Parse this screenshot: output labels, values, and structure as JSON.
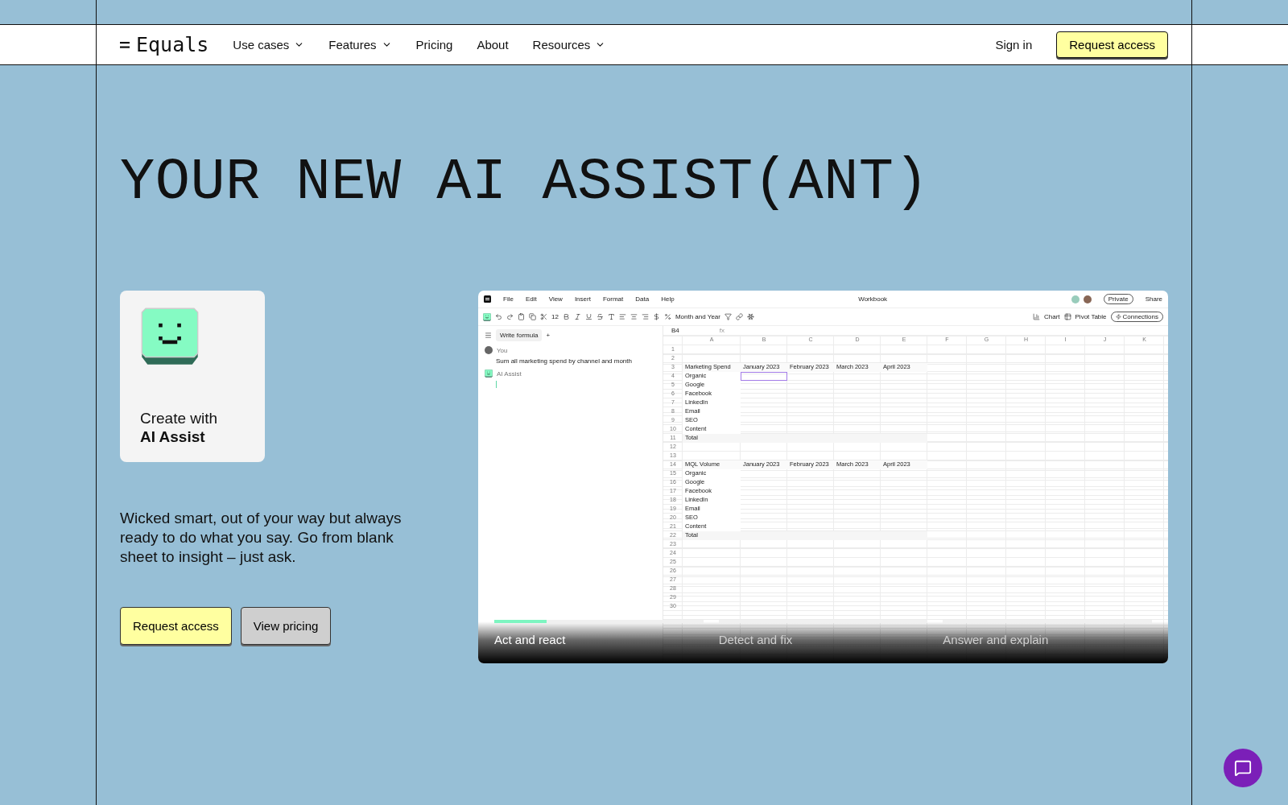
{
  "nav": {
    "logo": "Equals",
    "items": [
      {
        "label": "Use cases",
        "has_menu": true
      },
      {
        "label": "Features",
        "has_menu": true
      },
      {
        "label": "Pricing",
        "has_menu": false
      },
      {
        "label": "About",
        "has_menu": false
      },
      {
        "label": "Resources",
        "has_menu": true
      }
    ],
    "sign_in": "Sign in",
    "cta": "Request access"
  },
  "hero": {
    "headline": "YOUR NEW AI ASSIST(ANT)",
    "card": {
      "line1": "Create with",
      "line2": "AI Assist"
    },
    "description": "Wicked smart, out of your way but always ready to do what you say. Go from blank sheet to insight – just ask.",
    "buttons": [
      {
        "label": "Request access",
        "kind": "primary"
      },
      {
        "label": "View pricing",
        "kind": "secondary"
      }
    ]
  },
  "app": {
    "menu": [
      "File",
      "Edit",
      "View",
      "Insert",
      "Format",
      "Data",
      "Help"
    ],
    "title": "Workbook",
    "visibility": "Private",
    "share": "Share",
    "font_size": "12",
    "number_format": "Month and Year",
    "actions": [
      "Chart",
      "Pivot Table",
      "Connections"
    ],
    "panel": {
      "tab": "Write formula",
      "add": "+",
      "messages": [
        {
          "kind": "user",
          "author": "You",
          "text": "Sum all marketing spend by channel and month"
        },
        {
          "kind": "assistant",
          "author": "AI Assist"
        }
      ]
    },
    "cell_ref": "B4",
    "fx": "fx",
    "columns": [
      "A",
      "B",
      "C",
      "D",
      "E",
      "F",
      "G",
      "H",
      "I",
      "J",
      "K"
    ],
    "rows": [
      {
        "n": "1",
        "kind": "empty",
        "selected": false
      },
      {
        "n": "2",
        "kind": "empty",
        "selected": false
      },
      {
        "n": "3",
        "kind": "header",
        "cells": [
          "Marketing Spend",
          "January 2023",
          "February 2023",
          "March 2023",
          "April 2023"
        ],
        "selected": false
      },
      {
        "n": "4",
        "kind": "item",
        "cells": [
          "Organic"
        ],
        "selected": true
      },
      {
        "n": "5",
        "kind": "item",
        "cells": [
          "Google"
        ],
        "selected": false
      },
      {
        "n": "6",
        "kind": "item",
        "cells": [
          "Facebook"
        ],
        "selected": false
      },
      {
        "n": "7",
        "kind": "item",
        "cells": [
          "LinkedIn"
        ],
        "selected": false
      },
      {
        "n": "8",
        "kind": "item",
        "cells": [
          "Email"
        ],
        "selected": false
      },
      {
        "n": "9",
        "kind": "item",
        "cells": [
          "SEO"
        ],
        "selected": false
      },
      {
        "n": "10",
        "kind": "item",
        "cells": [
          "Content"
        ],
        "selected": false
      },
      {
        "n": "11",
        "kind": "total",
        "cells": [
          "Total"
        ],
        "selected": false
      },
      {
        "n": "12",
        "kind": "empty",
        "selected": false
      },
      {
        "n": "13",
        "kind": "empty",
        "selected": false
      },
      {
        "n": "14",
        "kind": "header",
        "cells": [
          "MQL Volume",
          "January 2023",
          "February 2023",
          "March 2023",
          "April 2023"
        ],
        "selected": false
      },
      {
        "n": "15",
        "kind": "item",
        "cells": [
          "Organic"
        ],
        "selected": false
      },
      {
        "n": "16",
        "kind": "item",
        "cells": [
          "Google"
        ],
        "selected": false
      },
      {
        "n": "17",
        "kind": "item",
        "cells": [
          "Facebook"
        ],
        "selected": false
      },
      {
        "n": "18",
        "kind": "item",
        "cells": [
          "LinkedIn"
        ],
        "selected": false
      },
      {
        "n": "19",
        "kind": "item",
        "cells": [
          "Email"
        ],
        "selected": false
      },
      {
        "n": "20",
        "kind": "item",
        "cells": [
          "SEO"
        ],
        "selected": false
      },
      {
        "n": "21",
        "kind": "item",
        "cells": [
          "Content"
        ],
        "selected": false
      },
      {
        "n": "22",
        "kind": "total",
        "cells": [
          "Total"
        ],
        "selected": false
      },
      {
        "n": "23",
        "kind": "empty",
        "selected": false
      },
      {
        "n": "24",
        "kind": "empty",
        "selected": false
      },
      {
        "n": "25",
        "kind": "empty",
        "selected": false
      },
      {
        "n": "26",
        "kind": "empty",
        "selected": false
      },
      {
        "n": "27",
        "kind": "empty",
        "selected": false
      },
      {
        "n": "28",
        "kind": "empty",
        "selected": false
      },
      {
        "n": "29",
        "kind": "empty",
        "selected": false
      },
      {
        "n": "30",
        "kind": "empty",
        "selected": false
      }
    ]
  },
  "slides": [
    {
      "label": "Act and react",
      "level": 0.25,
      "selected": true
    },
    {
      "label": "Detect and fix",
      "level": 0,
      "selected": false
    },
    {
      "label": "Answer and explain",
      "level": 0,
      "selected": false
    }
  ]
}
